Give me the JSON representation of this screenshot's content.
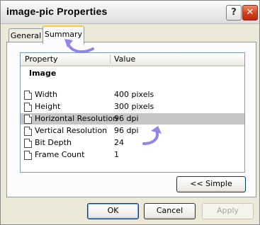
{
  "window": {
    "title": "image-pic Properties"
  },
  "titlebar_buttons": {
    "help": "?",
    "close": "✕"
  },
  "tabs": [
    {
      "label": "General",
      "active": false
    },
    {
      "label": "Summary",
      "active": true
    }
  ],
  "list": {
    "columns": {
      "property": "Property",
      "value": "Value"
    },
    "group": "Image",
    "rows": [
      {
        "property": "Width",
        "value": "400 pixels",
        "selected": false
      },
      {
        "property": "Height",
        "value": "300 pixels",
        "selected": false
      },
      {
        "property": "Horizontal Resolution",
        "value": "96 dpi",
        "selected": true
      },
      {
        "property": "Vertical Resolution",
        "value": "96 dpi",
        "selected": false
      },
      {
        "property": "Bit Depth",
        "value": "24",
        "selected": false
      },
      {
        "property": "Frame Count",
        "value": "1",
        "selected": false
      }
    ]
  },
  "buttons": {
    "simple": "<< Simple",
    "ok": "OK",
    "cancel": "Cancel",
    "apply": "Apply"
  },
  "colors": {
    "annotation_arrow": "#8f86e6",
    "selection": "#c6c6c6",
    "tab_highlight": "#ffc73a"
  }
}
